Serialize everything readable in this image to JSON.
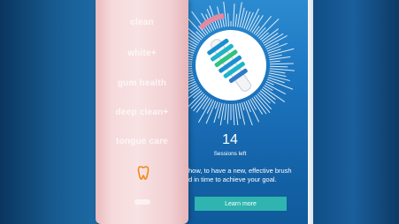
{
  "brush_modes": [
    "clean",
    "white+",
    "gum health",
    "deep clean+",
    "tongue care"
  ],
  "app": {
    "sessions_count": "14",
    "sessions_label": "Sessions left",
    "description_line1": "how, to have a new, effective brush",
    "description_line2": "d in time to achieve your goal.",
    "button_label": "Learn more"
  },
  "icons": {
    "brush_head_icon": "brush-head-icon",
    "mode_indicator": "tooth-icon"
  },
  "colors": {
    "handle_pink": "#f6dadc",
    "screen_blue": "#1c76c0",
    "button_teal": "#2fb4b0",
    "icon_orange": "#f08a1c"
  }
}
